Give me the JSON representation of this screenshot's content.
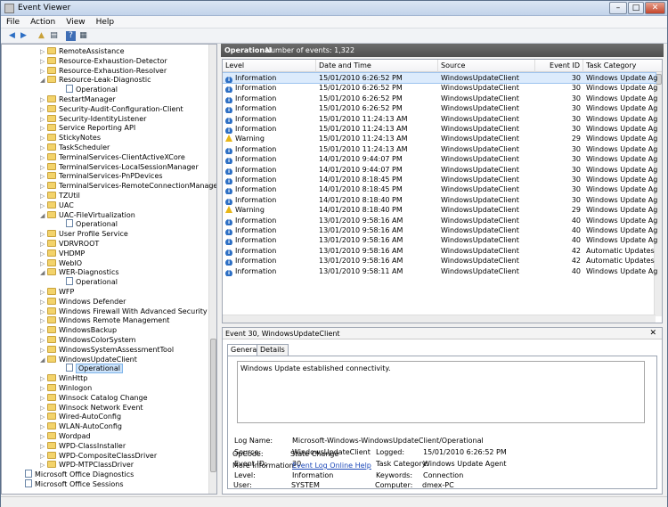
{
  "window": {
    "title": "Event Viewer",
    "minimize": "–",
    "maximize": "□",
    "close": "✕"
  },
  "menu": [
    "File",
    "Action",
    "View",
    "Help"
  ],
  "toolbar": [
    {
      "name": "back-icon",
      "glyph": "◀"
    },
    {
      "name": "forward-icon",
      "glyph": "▶"
    },
    {
      "name": "up-folder-icon",
      "glyph": "▲"
    },
    {
      "name": "show-hide-tree-icon",
      "glyph": "▤"
    },
    {
      "name": "help-icon",
      "glyph": "?"
    },
    {
      "name": "properties-icon",
      "glyph": "▦"
    }
  ],
  "tree": [
    {
      "label": "RemoteAssistance",
      "depth": 0,
      "icon": "folder",
      "twisty": "▷"
    },
    {
      "label": "Resource-Exhaustion-Detector",
      "depth": 0,
      "icon": "folder",
      "twisty": "▷"
    },
    {
      "label": "Resource-Exhaustion-Resolver",
      "depth": 0,
      "icon": "folder",
      "twisty": "▷"
    },
    {
      "label": "Resource-Leak-Diagnostic",
      "depth": 0,
      "icon": "folder",
      "twisty": "◢"
    },
    {
      "label": "Operational",
      "depth": 1,
      "icon": "log",
      "twisty": ""
    },
    {
      "label": "RestartManager",
      "depth": 0,
      "icon": "folder",
      "twisty": "▷"
    },
    {
      "label": "Security-Audit-Configuration-Client",
      "depth": 0,
      "icon": "folder",
      "twisty": "▷"
    },
    {
      "label": "Security-IdentityListener",
      "depth": 0,
      "icon": "folder",
      "twisty": "▷"
    },
    {
      "label": "Service Reporting API",
      "depth": 0,
      "icon": "folder",
      "twisty": "▷"
    },
    {
      "label": "StickyNotes",
      "depth": 0,
      "icon": "folder",
      "twisty": "▷"
    },
    {
      "label": "TaskScheduler",
      "depth": 0,
      "icon": "folder",
      "twisty": "▷"
    },
    {
      "label": "TerminalServices-ClientActiveXCore",
      "depth": 0,
      "icon": "folder",
      "twisty": "▷"
    },
    {
      "label": "TerminalServices-LocalSessionManager",
      "depth": 0,
      "icon": "folder",
      "twisty": "▷"
    },
    {
      "label": "TerminalServices-PnPDevices",
      "depth": 0,
      "icon": "folder",
      "twisty": "▷"
    },
    {
      "label": "TerminalServices-RemoteConnectionManager",
      "depth": 0,
      "icon": "folder",
      "twisty": "▷"
    },
    {
      "label": "TZUtil",
      "depth": 0,
      "icon": "folder",
      "twisty": "▷"
    },
    {
      "label": "UAC",
      "depth": 0,
      "icon": "folder",
      "twisty": "▷"
    },
    {
      "label": "UAC-FileVirtualization",
      "depth": 0,
      "icon": "folder",
      "twisty": "◢"
    },
    {
      "label": "Operational",
      "depth": 1,
      "icon": "log",
      "twisty": ""
    },
    {
      "label": "User Profile Service",
      "depth": 0,
      "icon": "folder",
      "twisty": "▷"
    },
    {
      "label": "VDRVROOT",
      "depth": 0,
      "icon": "folder",
      "twisty": "▷"
    },
    {
      "label": "VHDMP",
      "depth": 0,
      "icon": "folder",
      "twisty": "▷"
    },
    {
      "label": "WebIO",
      "depth": 0,
      "icon": "folder",
      "twisty": "▷"
    },
    {
      "label": "WER-Diagnostics",
      "depth": 0,
      "icon": "folder",
      "twisty": "◢"
    },
    {
      "label": "Operational",
      "depth": 1,
      "icon": "log",
      "twisty": ""
    },
    {
      "label": "WFP",
      "depth": 0,
      "icon": "folder",
      "twisty": "▷"
    },
    {
      "label": "Windows Defender",
      "depth": 0,
      "icon": "folder",
      "twisty": "▷"
    },
    {
      "label": "Windows Firewall With Advanced Security",
      "depth": 0,
      "icon": "folder",
      "twisty": "▷"
    },
    {
      "label": "Windows Remote Management",
      "depth": 0,
      "icon": "folder",
      "twisty": "▷"
    },
    {
      "label": "WindowsBackup",
      "depth": 0,
      "icon": "folder",
      "twisty": "▷"
    },
    {
      "label": "WindowsColorSystem",
      "depth": 0,
      "icon": "folder",
      "twisty": "▷"
    },
    {
      "label": "WindowsSystemAssessmentTool",
      "depth": 0,
      "icon": "folder",
      "twisty": "▷"
    },
    {
      "label": "WindowsUpdateClient",
      "depth": 0,
      "icon": "folder",
      "twisty": "◢"
    },
    {
      "label": "Operational",
      "depth": 1,
      "icon": "log",
      "twisty": "",
      "selected": true
    },
    {
      "label": "WinHttp",
      "depth": 0,
      "icon": "folder",
      "twisty": "▷"
    },
    {
      "label": "Winlogon",
      "depth": 0,
      "icon": "folder",
      "twisty": "▷"
    },
    {
      "label": "Winsock Catalog Change",
      "depth": 0,
      "icon": "folder",
      "twisty": "▷"
    },
    {
      "label": "Winsock Network Event",
      "depth": 0,
      "icon": "folder",
      "twisty": "▷"
    },
    {
      "label": "Wired-AutoConfig",
      "depth": 0,
      "icon": "folder",
      "twisty": "▷"
    },
    {
      "label": "WLAN-AutoConfig",
      "depth": 0,
      "icon": "folder",
      "twisty": "▷"
    },
    {
      "label": "Wordpad",
      "depth": 0,
      "icon": "folder",
      "twisty": "▷"
    },
    {
      "label": "WPD-ClassInstaller",
      "depth": 0,
      "icon": "folder",
      "twisty": "▷"
    },
    {
      "label": "WPD-CompositeClassDriver",
      "depth": 0,
      "icon": "folder",
      "twisty": "▷"
    },
    {
      "label": "WPD-MTPClassDriver",
      "depth": 0,
      "icon": "folder",
      "twisty": "▷"
    },
    {
      "label": "Microsoft Office Diagnostics",
      "depth": -1,
      "icon": "log",
      "twisty": ""
    },
    {
      "label": "Microsoft Office Sessions",
      "depth": -1,
      "icon": "log",
      "twisty": ""
    }
  ],
  "log_header": {
    "title": "Operational",
    "count_label": "Number of events: 1,322"
  },
  "columns": [
    "Level",
    "Date and Time",
    "Source",
    "Event ID",
    "Task Category"
  ],
  "events": [
    {
      "level": "Information",
      "date": "15/01/2010 6:26:52 PM",
      "source": "WindowsUpdateClient",
      "id": "30",
      "task": "Windows Update Agent",
      "selected": true
    },
    {
      "level": "Information",
      "date": "15/01/2010 6:26:52 PM",
      "source": "WindowsUpdateClient",
      "id": "30",
      "task": "Windows Update Agent"
    },
    {
      "level": "Information",
      "date": "15/01/2010 6:26:52 PM",
      "source": "WindowsUpdateClient",
      "id": "30",
      "task": "Windows Update Agent"
    },
    {
      "level": "Information",
      "date": "15/01/2010 6:26:52 PM",
      "source": "WindowsUpdateClient",
      "id": "30",
      "task": "Windows Update Agent"
    },
    {
      "level": "Information",
      "date": "15/01/2010 11:24:13 AM",
      "source": "WindowsUpdateClient",
      "id": "30",
      "task": "Windows Update Agent"
    },
    {
      "level": "Information",
      "date": "15/01/2010 11:24:13 AM",
      "source": "WindowsUpdateClient",
      "id": "30",
      "task": "Windows Update Agent"
    },
    {
      "level": "Warning",
      "date": "15/01/2010 11:24:13 AM",
      "source": "WindowsUpdateClient",
      "id": "29",
      "task": "Windows Update Agent"
    },
    {
      "level": "Information",
      "date": "15/01/2010 11:24:13 AM",
      "source": "WindowsUpdateClient",
      "id": "30",
      "task": "Windows Update Agent"
    },
    {
      "level": "Information",
      "date": "14/01/2010 9:44:07 PM",
      "source": "WindowsUpdateClient",
      "id": "30",
      "task": "Windows Update Agent"
    },
    {
      "level": "Information",
      "date": "14/01/2010 9:44:07 PM",
      "source": "WindowsUpdateClient",
      "id": "30",
      "task": "Windows Update Agent"
    },
    {
      "level": "Information",
      "date": "14/01/2010 8:18:45 PM",
      "source": "WindowsUpdateClient",
      "id": "30",
      "task": "Windows Update Agent"
    },
    {
      "level": "Information",
      "date": "14/01/2010 8:18:45 PM",
      "source": "WindowsUpdateClient",
      "id": "30",
      "task": "Windows Update Agent"
    },
    {
      "level": "Information",
      "date": "14/01/2010 8:18:40 PM",
      "source": "WindowsUpdateClient",
      "id": "30",
      "task": "Windows Update Agent"
    },
    {
      "level": "Warning",
      "date": "14/01/2010 8:18:40 PM",
      "source": "WindowsUpdateClient",
      "id": "29",
      "task": "Windows Update Agent"
    },
    {
      "level": "Information",
      "date": "13/01/2010 9:58:16 AM",
      "source": "WindowsUpdateClient",
      "id": "40",
      "task": "Windows Update Agent"
    },
    {
      "level": "Information",
      "date": "13/01/2010 9:58:16 AM",
      "source": "WindowsUpdateClient",
      "id": "40",
      "task": "Windows Update Agent"
    },
    {
      "level": "Information",
      "date": "13/01/2010 9:58:16 AM",
      "source": "WindowsUpdateClient",
      "id": "40",
      "task": "Windows Update Agent"
    },
    {
      "level": "Information",
      "date": "13/01/2010 9:58:16 AM",
      "source": "WindowsUpdateClient",
      "id": "42",
      "task": "Automatic Updates"
    },
    {
      "level": "Information",
      "date": "13/01/2010 9:58:16 AM",
      "source": "WindowsUpdateClient",
      "id": "42",
      "task": "Automatic Updates"
    },
    {
      "level": "Information",
      "date": "13/01/2010 9:58:11 AM",
      "source": "WindowsUpdateClient",
      "id": "40",
      "task": "Windows Update Agent"
    }
  ],
  "detail": {
    "title": "Event 30, WindowsUpdateClient",
    "tabs": [
      "General",
      "Details"
    ],
    "description": "Windows Update established connectivity.",
    "log_name_label": "Log Name:",
    "log_name": "Microsoft-Windows-WindowsUpdateClient/Operational",
    "source_label": "Source:",
    "source": "WindowsUpdateClient",
    "logged_label": "Logged:",
    "logged": "15/01/2010 6:26:52 PM",
    "event_id_label": "Event ID:",
    "event_id": "30",
    "task_label": "Task Category:",
    "task": "Windows Update Agent",
    "level_label": "Level:",
    "level": "Information",
    "keywords_label": "Keywords:",
    "keywords": "Connection",
    "user_label": "User:",
    "user": "SYSTEM",
    "computer_label": "Computer:",
    "computer": "dmex-PC",
    "opcode_label": "OpCode:",
    "opcode": "State Change",
    "more_label": "More Information:",
    "more_link": "Event Log Online Help"
  }
}
